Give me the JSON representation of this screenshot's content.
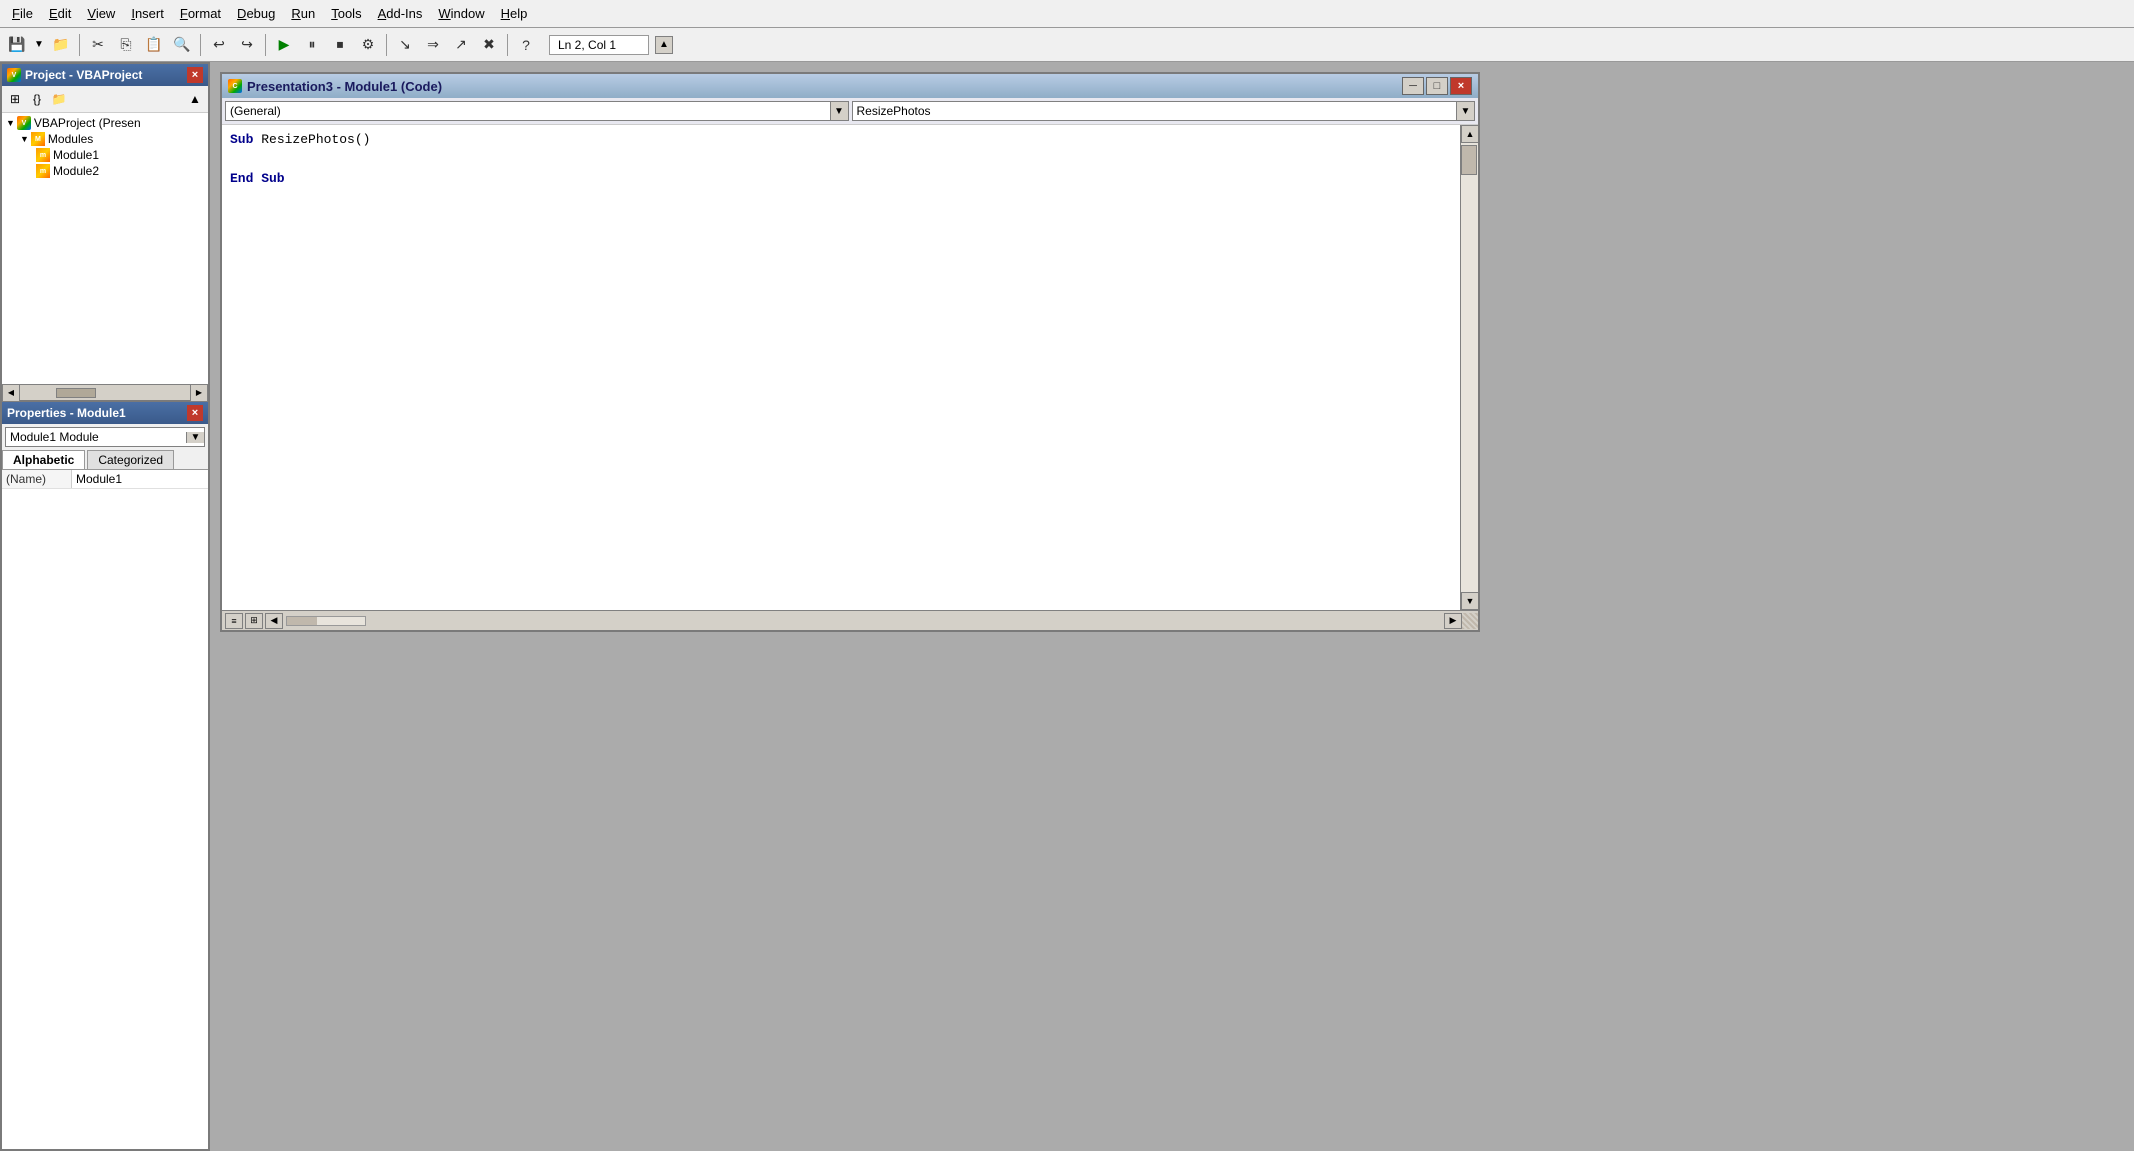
{
  "menubar": {
    "items": [
      {
        "label": "File",
        "underline_index": 0
      },
      {
        "label": "Edit",
        "underline_index": 0
      },
      {
        "label": "View",
        "underline_index": 0
      },
      {
        "label": "Insert",
        "underline_index": 0
      },
      {
        "label": "Format",
        "underline_index": 0
      },
      {
        "label": "Debug",
        "underline_index": 0
      },
      {
        "label": "Run",
        "underline_index": 0
      },
      {
        "label": "Tools",
        "underline_index": 0
      },
      {
        "label": "Add-Ins",
        "underline_index": 0
      },
      {
        "label": "Window",
        "underline_index": 0
      },
      {
        "label": "Help",
        "underline_index": 0
      }
    ]
  },
  "toolbar": {
    "status_text": "Ln 2, Col 1",
    "buttons": [
      {
        "name": "save-icon",
        "symbol": "💾"
      },
      {
        "name": "open-icon",
        "symbol": "📁"
      },
      {
        "name": "cut-icon",
        "symbol": "✂"
      },
      {
        "name": "copy-icon",
        "symbol": "📋"
      },
      {
        "name": "paste-icon",
        "symbol": "📌"
      },
      {
        "name": "find-icon",
        "symbol": "🔍"
      },
      {
        "name": "undo-icon",
        "symbol": "↩"
      },
      {
        "name": "redo-icon",
        "symbol": "↪"
      },
      {
        "name": "run-icon",
        "symbol": "▶"
      },
      {
        "name": "pause-icon",
        "symbol": "⏸"
      },
      {
        "name": "stop-icon",
        "symbol": "⏹"
      },
      {
        "name": "toggle-icon",
        "symbol": "⚡"
      },
      {
        "name": "step-in-icon",
        "symbol": "↘"
      },
      {
        "name": "step-over-icon",
        "symbol": "⇒"
      },
      {
        "name": "step-out-icon",
        "symbol": "↗"
      },
      {
        "name": "reset-icon",
        "symbol": "✖"
      },
      {
        "name": "help-icon",
        "symbol": "?"
      }
    ]
  },
  "project_panel": {
    "title": "Project - VBAProject",
    "root_item": {
      "label": "VBAProject (Presen",
      "children": [
        {
          "label": "Modules",
          "children": [
            {
              "label": "Module1"
            },
            {
              "label": "Module2"
            }
          ]
        }
      ]
    },
    "close_label": "×"
  },
  "properties_panel": {
    "title": "Properties - Module1",
    "close_label": "×",
    "dropdown_value": "Module1  Module",
    "tabs": [
      {
        "label": "Alphabetic",
        "active": true
      },
      {
        "label": "Categorized",
        "active": false
      }
    ],
    "rows": [
      {
        "key": "(Name)",
        "value": "Module1"
      }
    ]
  },
  "code_window": {
    "title": "Presentation3 - Module1 (Code)",
    "close_label": "×",
    "minimize_label": "─",
    "maximize_label": "□",
    "left_dropdown": "(General)",
    "right_dropdown": "ResizePhotos",
    "code_lines": [
      {
        "text": "Sub ResizePhotos()",
        "type": "sub"
      },
      {
        "text": "",
        "type": "normal"
      },
      {
        "text": "End Sub",
        "type": "sub"
      }
    ]
  }
}
